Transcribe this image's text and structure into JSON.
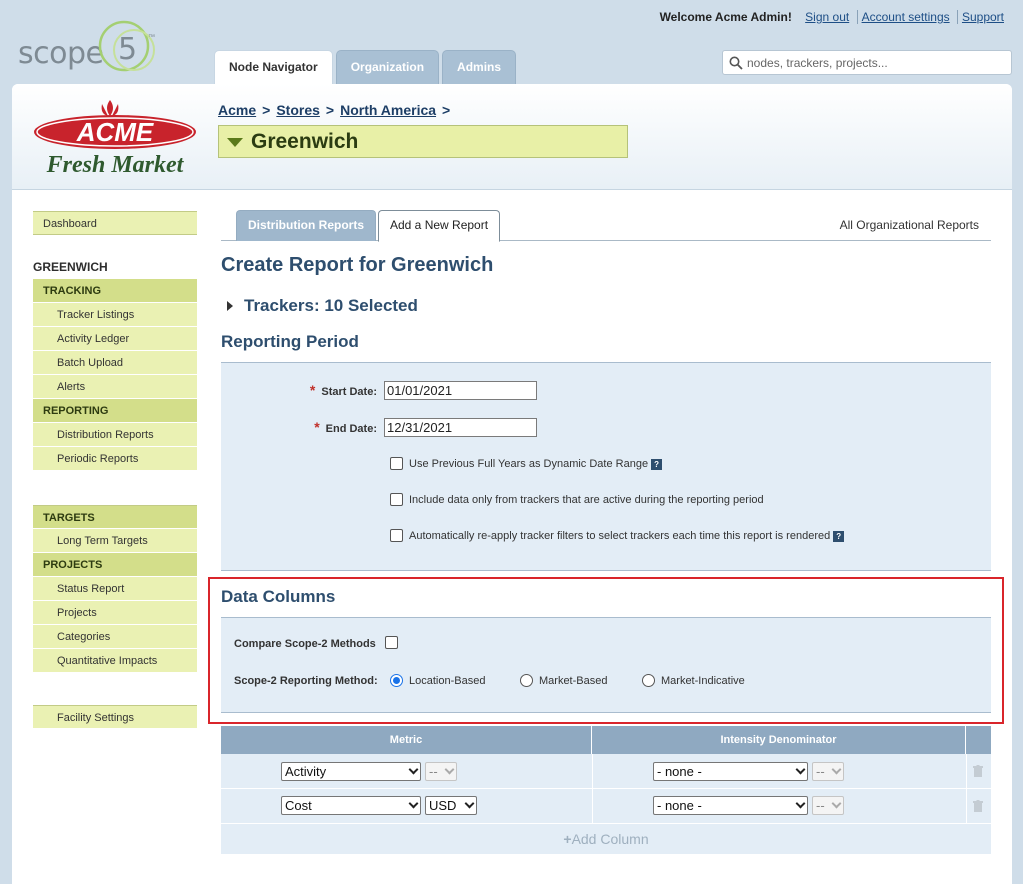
{
  "header": {
    "logo_word": "scope",
    "logo_num": "5",
    "logo_tm": "™",
    "welcome": "Welcome Acme Admin!",
    "links": [
      "Sign out",
      "Account settings",
      "Support"
    ],
    "tabs": [
      "Node Navigator",
      "Organization",
      "Admins"
    ],
    "active_tab": "Node Navigator",
    "search_placeholder": "nodes, trackers, projects..."
  },
  "node": {
    "breadcrumb": [
      "Acme",
      "Stores",
      "North America"
    ],
    "breadcrumb_sep": ">",
    "title": "Greenwich",
    "logo_top": "ACME",
    "logo_bottom": "Fresh Market"
  },
  "sidebar": {
    "dashboard": "Dashboard",
    "node_name": "GREENWICH",
    "tracking_head": "TRACKING",
    "tracking_items": [
      "Tracker Listings",
      "Activity Ledger",
      "Batch Upload",
      "Alerts"
    ],
    "reporting_head": "REPORTING",
    "reporting_items": [
      "Distribution Reports",
      "Periodic Reports"
    ],
    "targets_head": "TARGETS",
    "targets_items": [
      "Long Term Targets"
    ],
    "projects_head": "PROJECTS",
    "projects_items": [
      "Status Report",
      "Projects",
      "Categories",
      "Quantitative Impacts"
    ],
    "facility_settings": "Facility Settings"
  },
  "content": {
    "tabs": [
      "Distribution Reports",
      "Add a New Report"
    ],
    "active_tab": "Add a New Report",
    "all_reports_link": "All Organizational Reports",
    "page_title": "Create Report for Greenwich",
    "trackers_summary": "Trackers: 10 Selected",
    "reporting_period": {
      "heading": "Reporting Period",
      "required_marker": "*",
      "start_label": "Start Date:",
      "start_value": "01/01/2021",
      "end_label": "End Date:",
      "end_value": "12/31/2021",
      "help_glyph": "?",
      "options": [
        {
          "label": "Use Previous Full Years as Dynamic Date Range",
          "checked": false,
          "help": true
        },
        {
          "label": "Include data only from trackers that are active during the reporting period",
          "checked": false,
          "help": false
        },
        {
          "label": "Automatically re-apply tracker filters to select trackers each time this report is rendered",
          "checked": false,
          "help": true
        }
      ]
    },
    "data_columns": {
      "heading": "Data Columns",
      "compare_label": "Compare Scope-2 Methods",
      "compare_checked": false,
      "method_label": "Scope-2 Reporting Method:",
      "methods": [
        "Location-Based",
        "Market-Based",
        "Market-Indicative"
      ],
      "selected_method": "Location-Based"
    },
    "table": {
      "headers": [
        "Metric",
        "Intensity Denominator"
      ],
      "rows": [
        {
          "metric": "Activity",
          "unit": "--",
          "unit_enabled": false,
          "denominator": "- none -",
          "den_unit": "--"
        },
        {
          "metric": "Cost",
          "unit": "USD",
          "unit_enabled": true,
          "denominator": "- none -",
          "den_unit": "--"
        }
      ],
      "add_column_icon": "+",
      "add_column": "Add Column"
    }
  },
  "colors": {
    "accent_blue": "#2e4e6e",
    "sidebar_green": "#eaf1b3",
    "highlight_red": "#d9252b"
  }
}
